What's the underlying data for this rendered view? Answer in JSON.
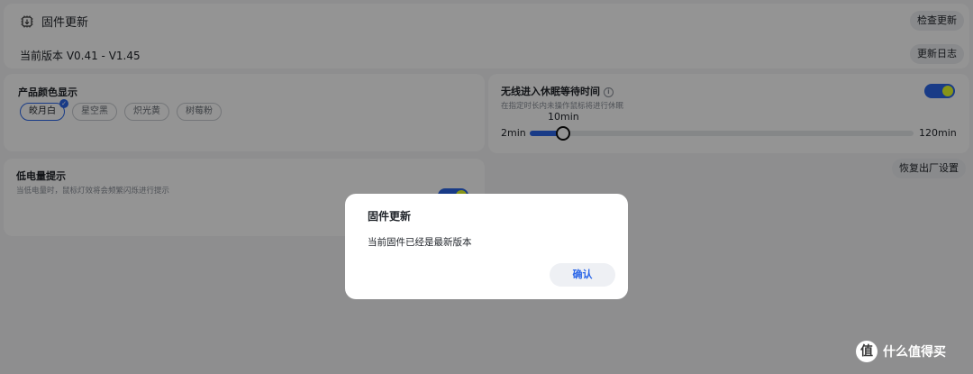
{
  "firmware": {
    "title": "固件更新",
    "version_text": "当前版本 V0.41 - V1.45",
    "check_update_label": "检查更新",
    "changelog_label": "更新日志"
  },
  "product_color": {
    "title": "产品颜色显示",
    "options": [
      "皎月白",
      "星空黑",
      "炽光黄",
      "树莓粉"
    ],
    "selected": "皎月白"
  },
  "sleep": {
    "title": "无线进入休眠等待时间",
    "description": "在指定时长内未操作鼠标将进行休眠",
    "toggle_on": true,
    "min_label": "2min",
    "max_label": "120min",
    "current_label": "10min",
    "slider_value_min": 10
  },
  "low_battery": {
    "title": "低电量提示",
    "description": "当低电量时，鼠标灯效将会频繁闪烁进行提示",
    "toggle_on": true
  },
  "reset_label": "恢复出厂设置",
  "dialog": {
    "title": "固件更新",
    "message": "当前固件已经是最新版本",
    "confirm_label": "确认"
  },
  "watermark": {
    "logo": "值",
    "text": "什么值得买"
  },
  "colors": {
    "accent": "#2b66e8",
    "toggle_knob": "#e8ff2a",
    "overlay": "rgba(0,0,0,0.42)"
  }
}
